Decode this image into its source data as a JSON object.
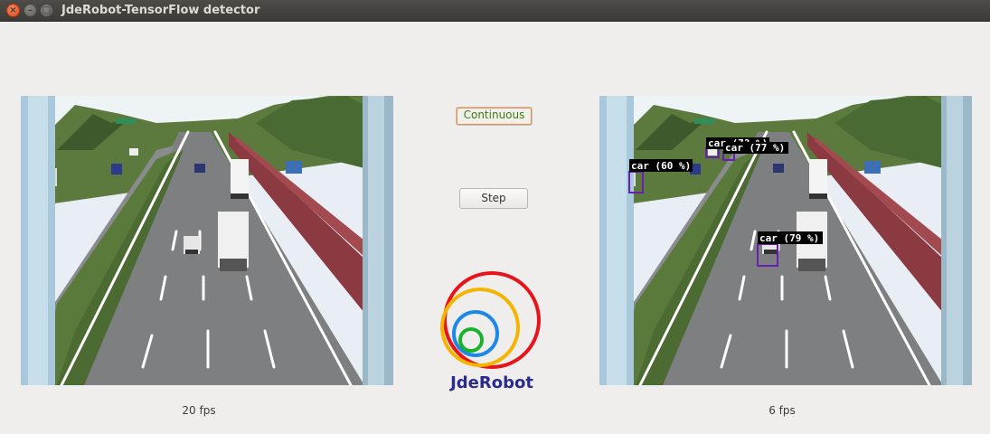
{
  "window": {
    "title": "JdeRobot-TensorFlow detector"
  },
  "controls": {
    "continuous_label": "Continuous",
    "step_label": "Step"
  },
  "logo": {
    "text": "JdeRobot"
  },
  "input_view": {
    "fps": "20 fps"
  },
  "output_view": {
    "fps": "6 fps",
    "detections": [
      {
        "label": "car (60 %)"
      },
      {
        "label": "car (7? %)"
      },
      {
        "label": "car (77 %)"
      },
      {
        "label": "car (79 %)"
      }
    ]
  },
  "colors": {
    "bbox": "#6a1fb3",
    "titlebar": "#3c3b37",
    "logo_text": "#2a2a8f"
  }
}
